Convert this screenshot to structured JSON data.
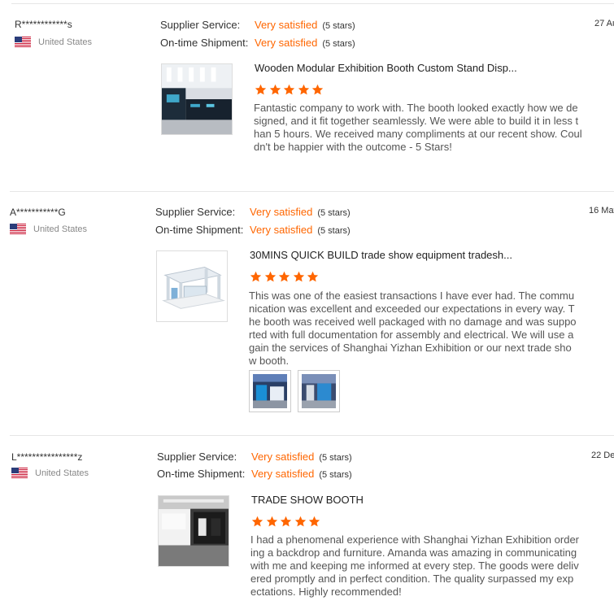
{
  "reviews": [
    {
      "buyer": "R************s",
      "country": "United States",
      "date": "27 Au",
      "supplier_service": {
        "label": "Supplier Service:",
        "value": "Very satisfied",
        "stars": "(5 stars)"
      },
      "shipment": {
        "label": "On-time Shipment:",
        "value": "Very satisfied",
        "stars": "(5 stars)"
      },
      "product_title": "Wooden Modular Exhibition Booth Custom Stand Disp...",
      "rating": 5,
      "text": "Fantastic company to work with. The booth looked exactly how we designed, and it fit together seamlessly. We were able to build it in less than 5 hours. We received many compliments at our recent show. Couldn't be happier with the outcome - 5 Stars!"
    },
    {
      "buyer": "A***********G",
      "country": "United States",
      "date": "16 May",
      "supplier_service": {
        "label": "Supplier Service:",
        "value": "Very satisfied",
        "stars": "(5 stars)"
      },
      "shipment": {
        "label": "On-time Shipment:",
        "value": "Very satisfied",
        "stars": "(5 stars)"
      },
      "product_title": "30MINS QUICK BUILD trade show equipment tradesh...",
      "rating": 5,
      "text": "This was one of the easiest transactions I have ever had.  The communication was excellent and exceeded our expectations in every way. The booth was received well packaged with no damage and was supported with full documentation for assembly and electrical. We will use again the services of Shanghai Yizhan Exhibition or our next trade show booth."
    },
    {
      "buyer": "L****************z",
      "country": "United States",
      "date": "22 De",
      "supplier_service": {
        "label": "Supplier Service:",
        "value": "Very satisfied",
        "stars": "(5 stars)"
      },
      "shipment": {
        "label": "On-time Shipment:",
        "value": "Very satisfied",
        "stars": "(5 stars)"
      },
      "product_title": "TRADE SHOW BOOTH",
      "rating": 5,
      "text": "I had a phenomenal experience with Shanghai Yizhan Exhibition ordering a backdrop and furniture. Amanda was amazing in communicating with me and keeping me informed at every step. The goods were delivered promptly and in perfect condition. The quality surpassed my expectations. Highly recommended!"
    }
  ],
  "colors": {
    "accent": "#ff6600",
    "muted": "#888888",
    "divider": "#e6e6e6"
  },
  "icons": {
    "flag": "us-flag-icon",
    "star": "star-icon"
  }
}
